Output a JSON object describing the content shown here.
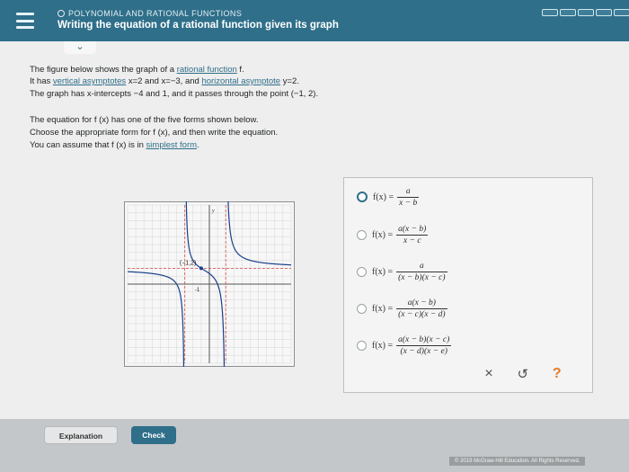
{
  "header": {
    "topic": "POLYNOMIAL AND RATIONAL FUNCTIONS",
    "title": "Writing the equation of a rational function given its graph",
    "collapse_glyph": "⌄"
  },
  "problem": {
    "line1_pre": "The figure below shows the graph of a ",
    "line1_link": "rational function",
    "line1_post": " f.",
    "line2_pre": "It has ",
    "line2_link1": "vertical asymptotes",
    "line2_mid1": " x=2 and x=−3, and ",
    "line2_link2": "horizontal asymptote",
    "line2_mid2": " y=2.",
    "line3": "The graph has x-intercepts −4 and 1, and it passes through the point (−1, 2).",
    "line4": "The equation for f (x) has one of the five forms shown below.",
    "line5": "Choose the appropriate form for f (x), and then write the equation.",
    "line6_pre": "You can assume that f (x) is in ",
    "line6_link": "simplest form",
    "line6_post": "."
  },
  "graph": {
    "point_label": "(−1,2)",
    "y_label": "y",
    "tick_label": "-1",
    "chart_data": {
      "type": "line",
      "vertical_asymptotes": [
        2,
        -3
      ],
      "horizontal_asymptote": 2,
      "x_intercepts": [
        -4,
        1
      ],
      "point": [
        -1,
        2
      ],
      "xlim": [
        -10,
        10
      ],
      "ylim": [
        -10,
        10
      ],
      "grid": true
    }
  },
  "options": [
    {
      "lhs": "f(x) =",
      "num": "a",
      "den": "x − b",
      "selected": true
    },
    {
      "lhs": "f(x) =",
      "num": "a(x − b)",
      "den": "x − c",
      "selected": false
    },
    {
      "lhs": "f(x) =",
      "num": "a",
      "den": "(x − b)(x − c)",
      "selected": false
    },
    {
      "lhs": "f(x) =",
      "num": "a(x − b)",
      "den": "(x − c)(x − d)",
      "selected": false
    },
    {
      "lhs": "f(x) =",
      "num": "a(x − b)(x − c)",
      "den": "(x − d)(x − e)",
      "selected": false
    }
  ],
  "tools": {
    "clear": "×",
    "undo": "↺",
    "help": "?"
  },
  "buttons": {
    "explanation": "Explanation",
    "check": "Check"
  },
  "footer": {
    "copyright": "© 2019 McGraw-Hill Education. All Rights Reserved."
  },
  "colors": {
    "brand": "#2f6f8a",
    "help": "#e07a2b"
  }
}
